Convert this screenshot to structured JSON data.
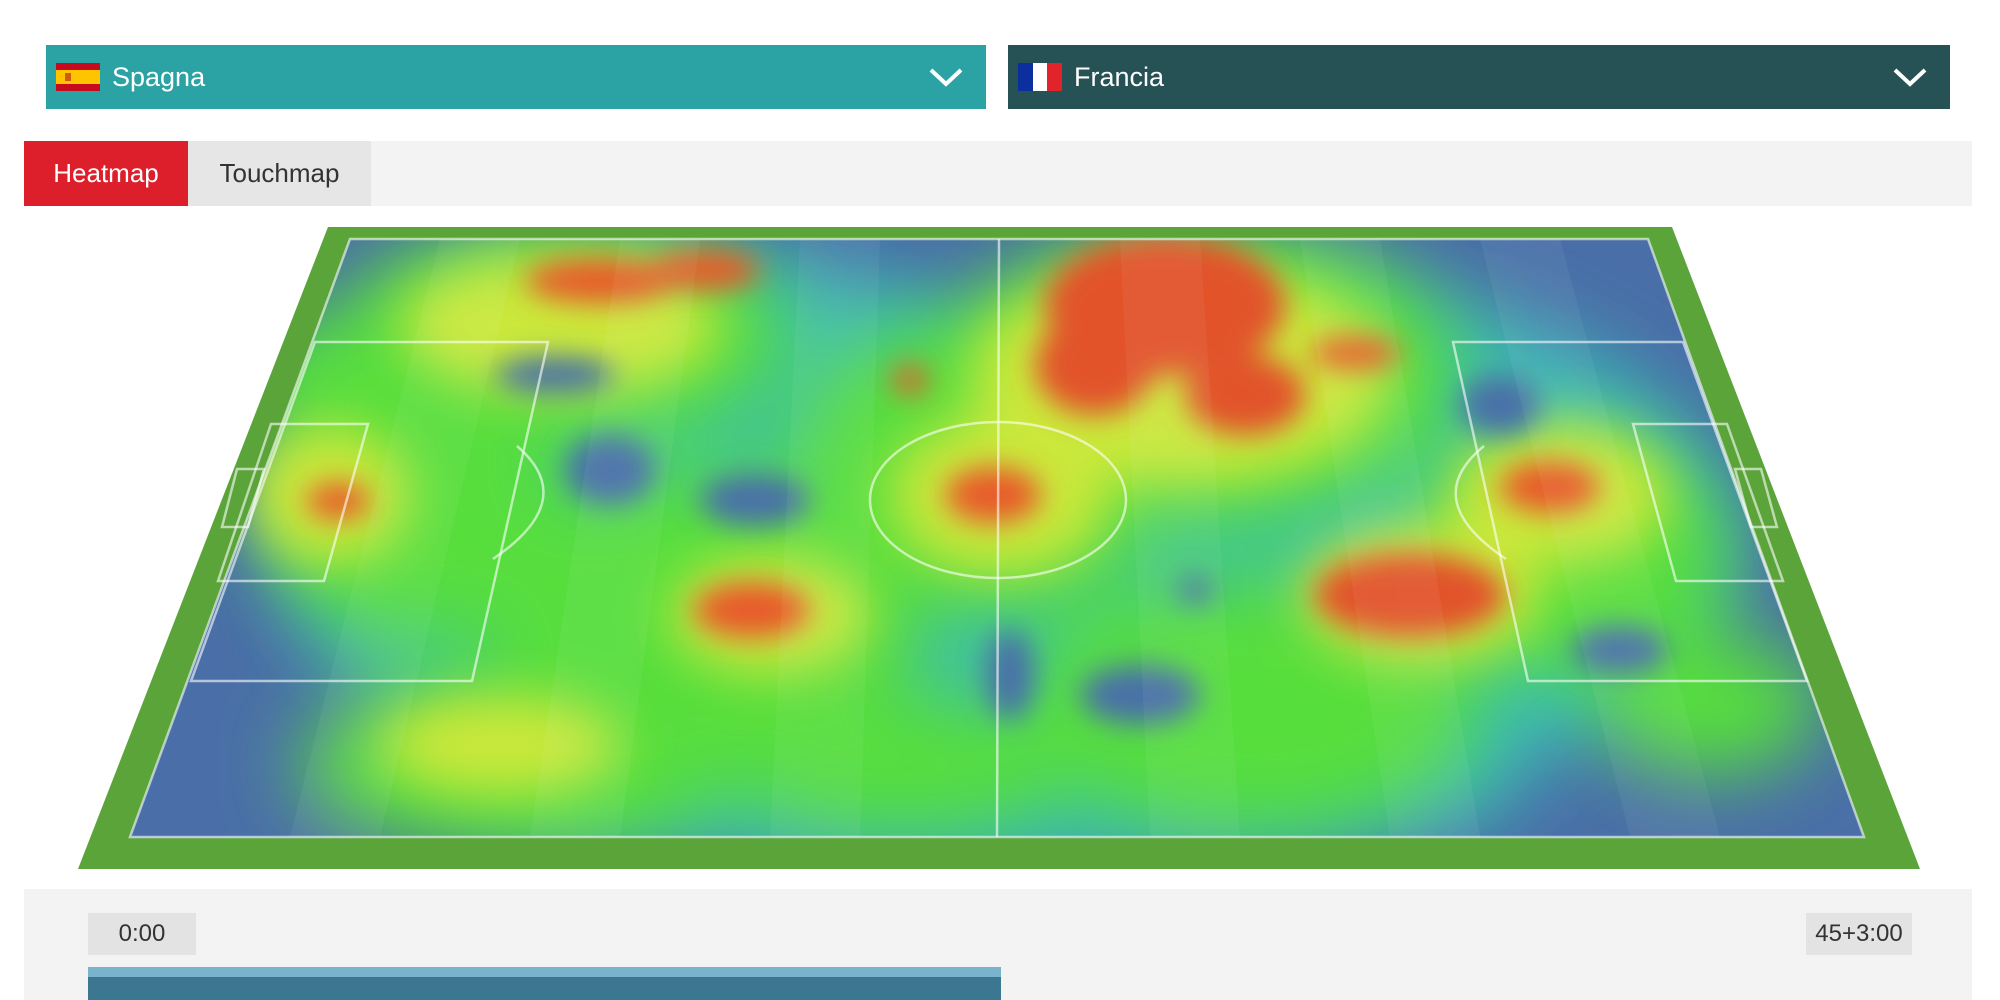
{
  "team_left": {
    "name": "Spagna",
    "flag_icon": "spain-flag-icon",
    "color": "#2ba3a4"
  },
  "team_right": {
    "name": "Francia",
    "flag_icon": "france-flag-icon",
    "color": "#265256"
  },
  "tabs": [
    {
      "label": "Heatmap",
      "active": true,
      "color": "#dd1f2b"
    },
    {
      "label": "Touchmap",
      "active": false
    }
  ],
  "timeline": {
    "start_label": "0:00",
    "end_label": "45+3:00",
    "progress_fraction": 0.5
  }
}
